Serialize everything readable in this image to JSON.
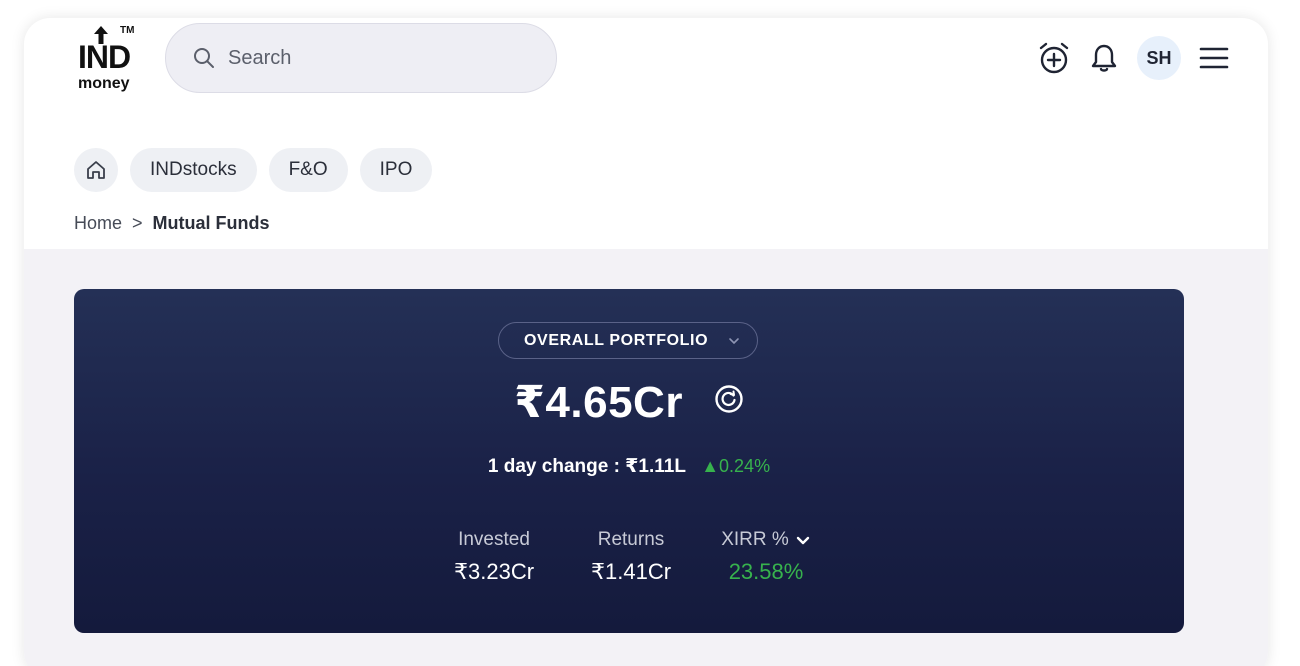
{
  "brand": {
    "name": "IND",
    "sub": "money",
    "tm": "TM"
  },
  "search": {
    "placeholder": "Search"
  },
  "header": {
    "avatar_initials": "SH",
    "icons": [
      "alarm-add-icon",
      "bell-icon",
      "menu-icon"
    ]
  },
  "nav_chips": [
    {
      "label": "INDstocks"
    },
    {
      "label": "F&O"
    },
    {
      "label": "IPO"
    }
  ],
  "breadcrumb": {
    "home": "Home",
    "separator": ">",
    "current": "Mutual Funds"
  },
  "portfolio": {
    "selector_label": "OVERALL PORTFOLIO",
    "value": "₹4.65Cr",
    "day_change_label": "1 day change : ₹1.11L",
    "day_change_pct": "▲0.24%",
    "stats": {
      "invested_label": "Invested",
      "invested_value": "₹3.23Cr",
      "returns_label": "Returns",
      "returns_value": "₹1.41Cr",
      "xirr_label": "XIRR %",
      "xirr_value": "23.58%"
    }
  },
  "colors": {
    "positive": "#37b24d",
    "card_bg_top": "#243056",
    "card_bg_bottom": "#141a3c",
    "page_bg": "#f3f2f6"
  }
}
